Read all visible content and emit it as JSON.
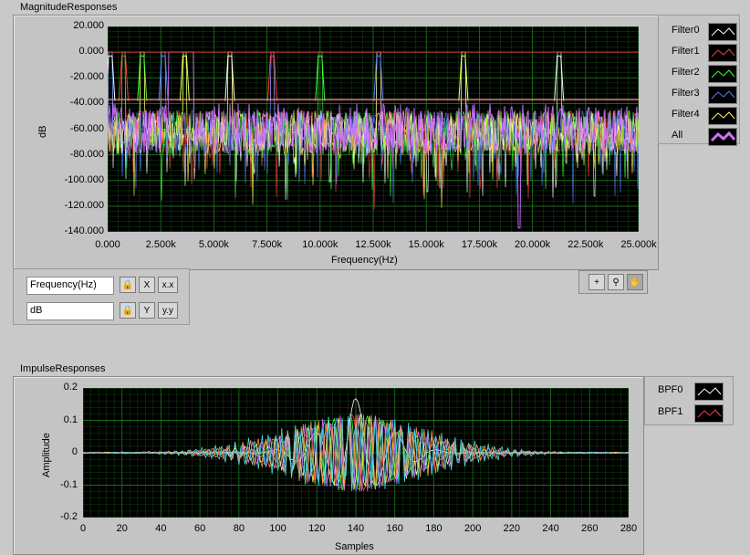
{
  "graph1": {
    "title": "MagnitudeResponses",
    "y_axis_label": "dB",
    "x_axis_label": "Frequency(Hz)",
    "y_ticks": [
      "20.000",
      "0.000",
      "-20.000",
      "-40.000",
      "-60.000",
      "-80.000",
      "-100.000",
      "-120.000",
      "-140.000"
    ],
    "x_ticks": [
      "0.000",
      "2.500k",
      "5.000k",
      "7.500k",
      "10.000k",
      "12.500k",
      "15.000k",
      "17.500k",
      "20.000k",
      "22.500k",
      "25.000k"
    ],
    "legend": [
      "Filter0",
      "Filter1",
      "Filter2",
      "Filter3",
      "Filter4",
      "All"
    ],
    "x_scale_name": "Frequency(Hz)",
    "y_scale_name": "dB"
  },
  "graph2": {
    "title": "ImpulseResponses",
    "y_axis_label": "Amplitude",
    "x_axis_label": "Samples",
    "y_ticks": [
      "0.2",
      "0.1",
      "0",
      "-0.1",
      "-0.2"
    ],
    "x_ticks": [
      "0",
      "20",
      "40",
      "60",
      "80",
      "100",
      "120",
      "140",
      "160",
      "180",
      "200",
      "220",
      "240",
      "260",
      "280"
    ],
    "legend": [
      "BPF0",
      "BPF1"
    ]
  },
  "icons": {
    "lock": "lock-icon",
    "autoscale_x": "autoscale-x-icon",
    "autoscale_y": "autoscale-y-icon",
    "format_x": "format-x-icon",
    "format_y": "format-y-icon",
    "cursor": "cursor-icon",
    "zoom": "zoom-icon",
    "pan": "pan-hand-icon"
  },
  "colors": {
    "background": "#c9c9c9",
    "plot_bg": "#000000",
    "grid": "#1e7a1e",
    "filter0": "#ffffff",
    "filter1": "#ff4040",
    "filter2": "#40ff40",
    "filter3": "#5080ff",
    "filter4": "#ffff60",
    "all": "#d070ff"
  }
}
